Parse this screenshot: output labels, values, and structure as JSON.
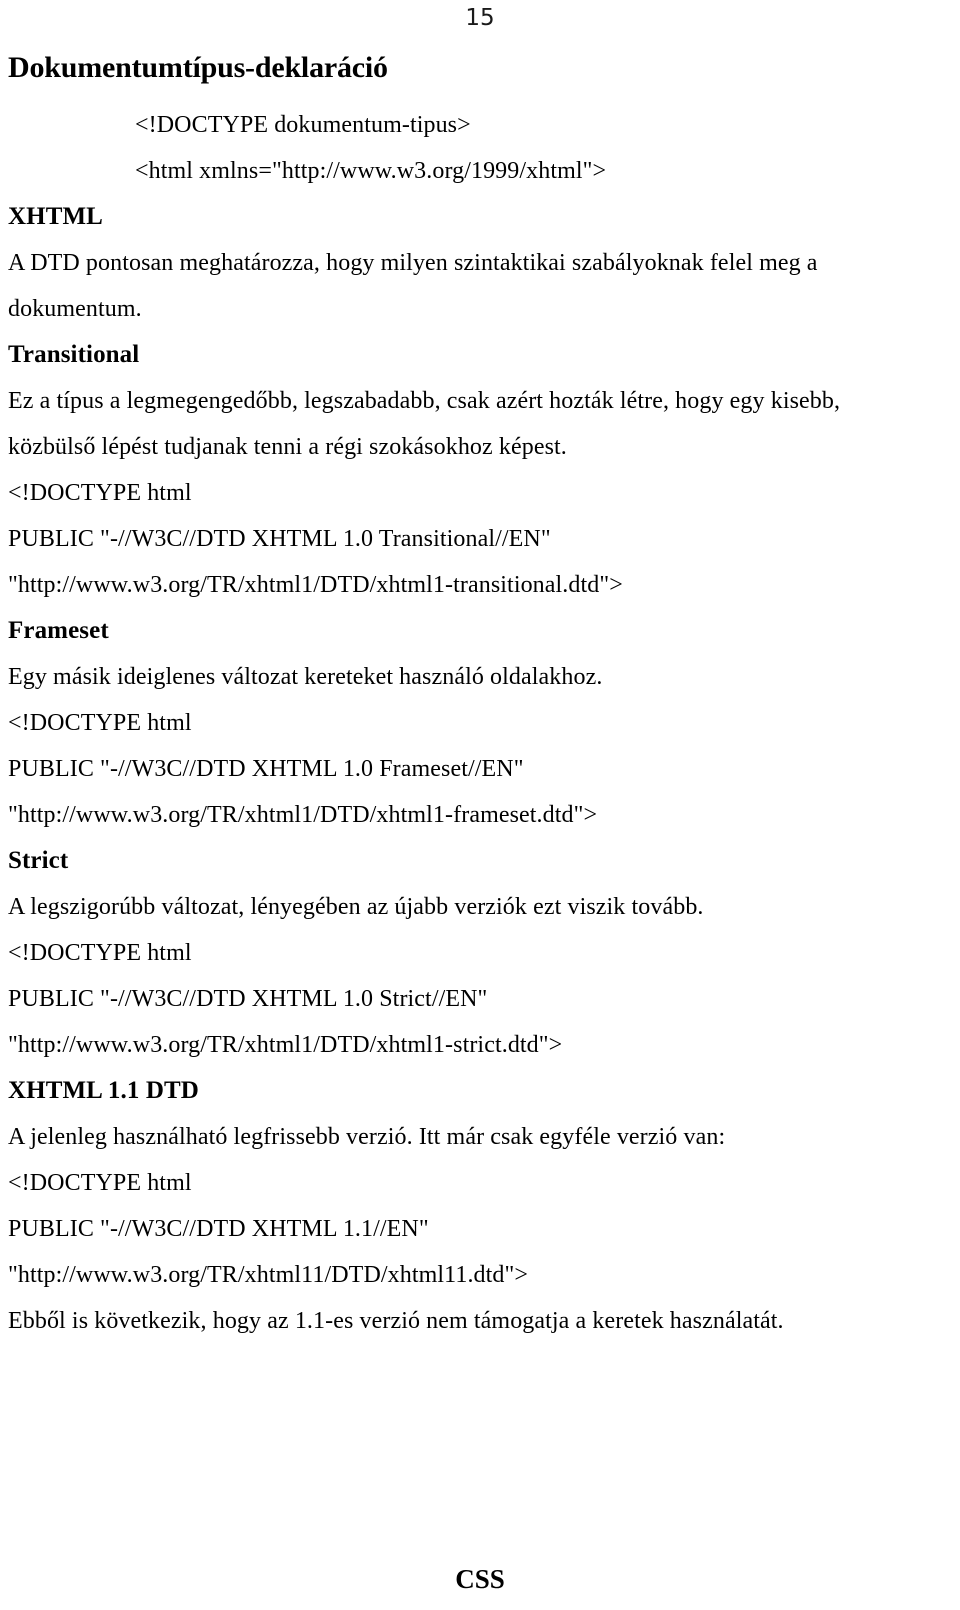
{
  "page": {
    "number": "15",
    "footer_heading": "CSS"
  },
  "headings": {
    "main": "Dokumentumtípus-deklaráció",
    "xhtml": "XHTML",
    "transitional": "Transitional",
    "frameset": "Frameset",
    "strict": "Strict",
    "xhtml11": "XHTML 1.1 DTD"
  },
  "intro": {
    "doctype_generic": "<!DOCTYPE dokumentum-tipus>",
    "html_root": "<html xmlns=\"http://www.w3.org/1999/xhtml\">",
    "dtd_explanation_line1": "A DTD pontosan meghatározza, hogy milyen szintaktikai szabályoknak felel meg a",
    "dtd_explanation_line2": "dokumentum."
  },
  "transitional": {
    "description_line1": "Ez a típus a legmegengedőbb, legszabadabb, csak azért hozták létre, hogy egy kisebb,",
    "description_line2": "közbülső lépést tudjanak tenni a régi szokásokhoz képest.",
    "doctype_line1": "<!DOCTYPE html",
    "doctype_line2": "PUBLIC \"-//W3C//DTD XHTML 1.0 Transitional//EN\"",
    "doctype_line3": "\"http://www.w3.org/TR/xhtml1/DTD/xhtml1-transitional.dtd\">"
  },
  "frameset": {
    "description": "Egy másik ideiglenes változat kereteket használó oldalakhoz.",
    "doctype_line1": "<!DOCTYPE html",
    "doctype_line2": "PUBLIC \"-//W3C//DTD XHTML 1.0 Frameset//EN\"",
    "doctype_line3": "\"http://www.w3.org/TR/xhtml1/DTD/xhtml1-frameset.dtd\">"
  },
  "strict": {
    "description": "A legszigorúbb változat, lényegében az újabb verziók ezt viszik tovább.",
    "doctype_line1": "<!DOCTYPE html",
    "doctype_line2": "PUBLIC \"-//W3C//DTD XHTML 1.0 Strict//EN\"",
    "doctype_line3": "\"http://www.w3.org/TR/xhtml1/DTD/xhtml1-strict.dtd\">"
  },
  "xhtml11": {
    "description": "A jelenleg használható legfrissebb verzió. Itt már csak egyféle verzió van:",
    "doctype_line1": "<!DOCTYPE html",
    "doctype_line2": "PUBLIC \"-//W3C//DTD XHTML 1.1//EN\"",
    "doctype_line3": "\"http://www.w3.org/TR/xhtml11/DTD/xhtml11.dtd\">",
    "conclusion": "Ebből is következik, hogy az 1.1-es verzió nem támogatja a keretek használatát."
  }
}
